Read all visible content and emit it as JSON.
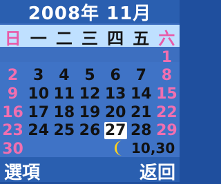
{
  "header": {
    "title": "2008年 11月"
  },
  "weekdays": [
    "日",
    "一",
    "二",
    "三",
    "四",
    "五",
    "六"
  ],
  "weeks": [
    [
      "",
      "",
      "",
      "",
      "",
      "",
      "1"
    ],
    [
      "2",
      "3",
      "4",
      "5",
      "6",
      "7",
      "8"
    ],
    [
      "9",
      "10",
      "11",
      "12",
      "13",
      "14",
      "15"
    ],
    [
      "16",
      "17",
      "18",
      "19",
      "20",
      "21",
      "22"
    ],
    [
      "23",
      "24",
      "25",
      "26",
      "27",
      "28",
      "29"
    ],
    [
      "30",
      "",
      "",
      "",
      "",
      "",
      ""
    ]
  ],
  "today": "27",
  "lunar_date": "10,30",
  "moon_icon": "crescent-moon-icon",
  "colors": {
    "background": "#3f73c6",
    "weekday_bar": "#bfe0ff",
    "weekend": "#f06fb0",
    "today_highlight": "#ffffff"
  },
  "softkeys": {
    "left": "選項",
    "right": "返回"
  }
}
